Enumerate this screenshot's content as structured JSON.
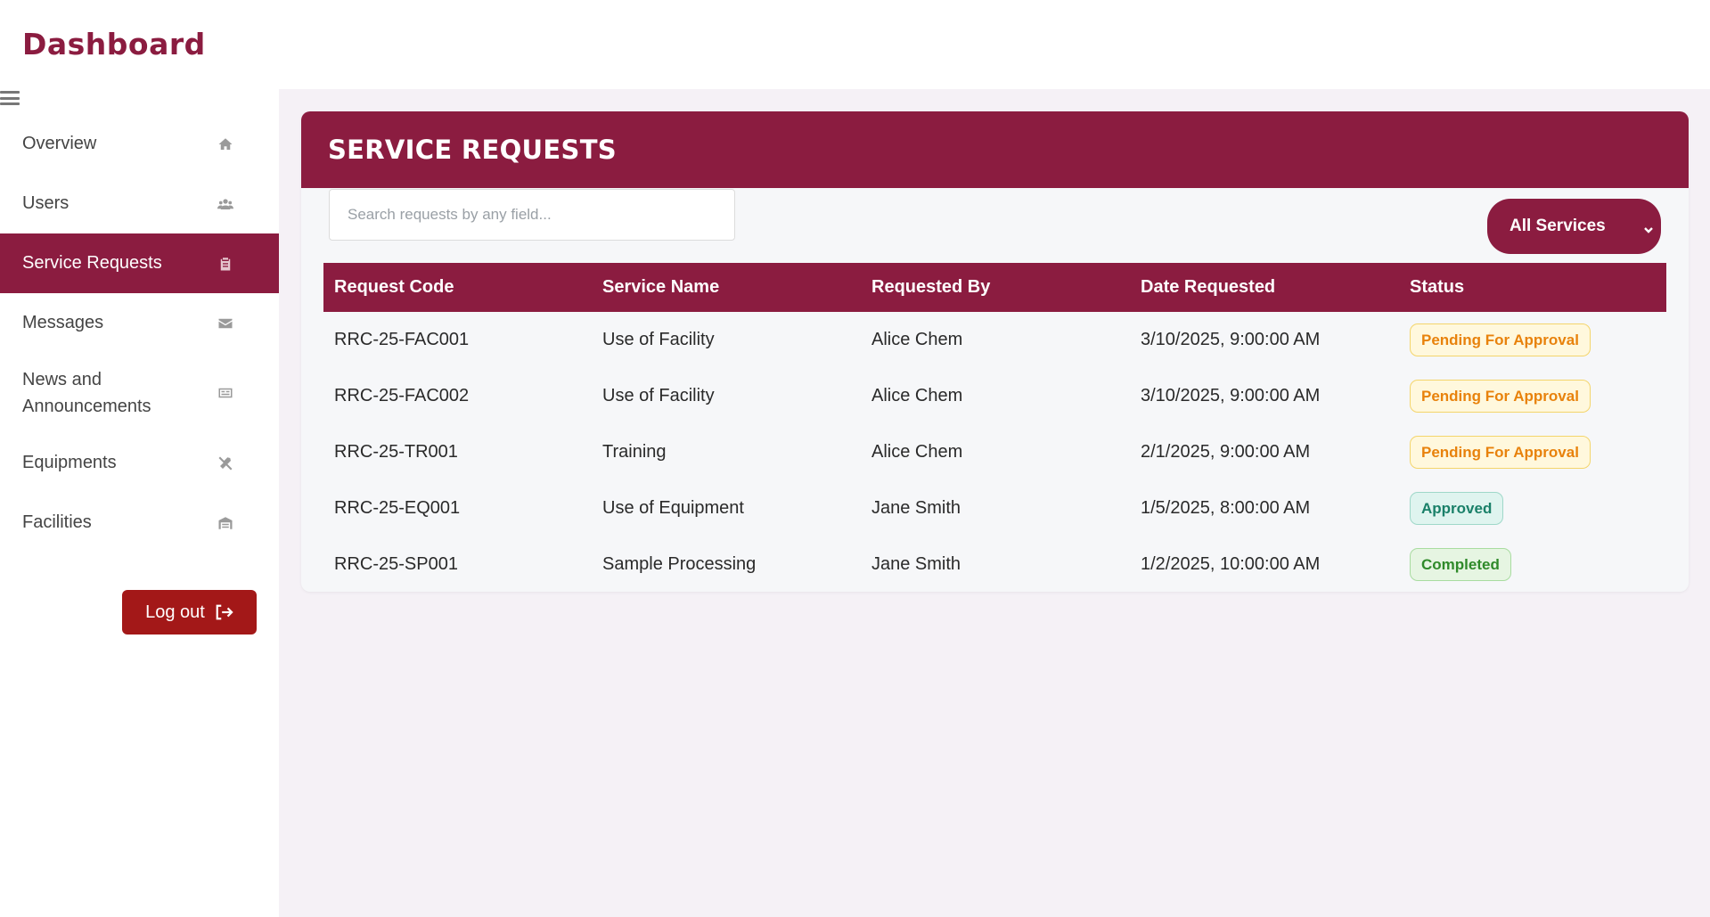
{
  "app": {
    "title": "Dashboard"
  },
  "sidebar": {
    "items": [
      {
        "label": "Overview",
        "icon": "home-icon"
      },
      {
        "label": "Users",
        "icon": "users-icon"
      },
      {
        "label": "Service Requests",
        "icon": "clipboard-icon",
        "active": true
      },
      {
        "label": "Messages",
        "icon": "envelope-icon"
      },
      {
        "label": "News and Announcements",
        "icon": "newspaper-icon"
      },
      {
        "label": "Equipments",
        "icon": "tools-icon"
      },
      {
        "label": "Facilities",
        "icon": "warehouse-icon"
      }
    ],
    "logout_label": "Log out"
  },
  "main": {
    "title": "SERVICE REQUESTS",
    "search": {
      "placeholder": "Search requests by any field...",
      "value": ""
    },
    "service_filter": {
      "selected": "All Services"
    },
    "table": {
      "headers": [
        "Request Code",
        "Service Name",
        "Requested By",
        "Date Requested",
        "Status"
      ],
      "rows": [
        {
          "code": "RRC-25-FAC001",
          "service": "Use of Facility",
          "by": "Alice Chem",
          "date": "3/10/2025, 9:00:00 AM",
          "status": "Pending For Approval",
          "status_type": "pending"
        },
        {
          "code": "RRC-25-FAC002",
          "service": "Use of Facility",
          "by": "Alice Chem",
          "date": "3/10/2025, 9:00:00 AM",
          "status": "Pending For Approval",
          "status_type": "pending"
        },
        {
          "code": "RRC-25-TR001",
          "service": "Training",
          "by": "Alice Chem",
          "date": "2/1/2025, 9:00:00 AM",
          "status": "Pending For Approval",
          "status_type": "pending"
        },
        {
          "code": "RRC-25-EQ001",
          "service": "Use of Equipment",
          "by": "Jane Smith",
          "date": "1/5/2025, 8:00:00 AM",
          "status": "Approved",
          "status_type": "approved"
        },
        {
          "code": "RRC-25-SP001",
          "service": "Sample Processing",
          "by": "Jane Smith",
          "date": "1/2/2025, 10:00:00 AM",
          "status": "Completed",
          "status_type": "completed"
        }
      ]
    }
  },
  "colors": {
    "brand": "#8b1c40",
    "logout": "#a31818",
    "pending": "#e8820c",
    "approved": "#1a8069",
    "completed": "#2f8a2a"
  }
}
